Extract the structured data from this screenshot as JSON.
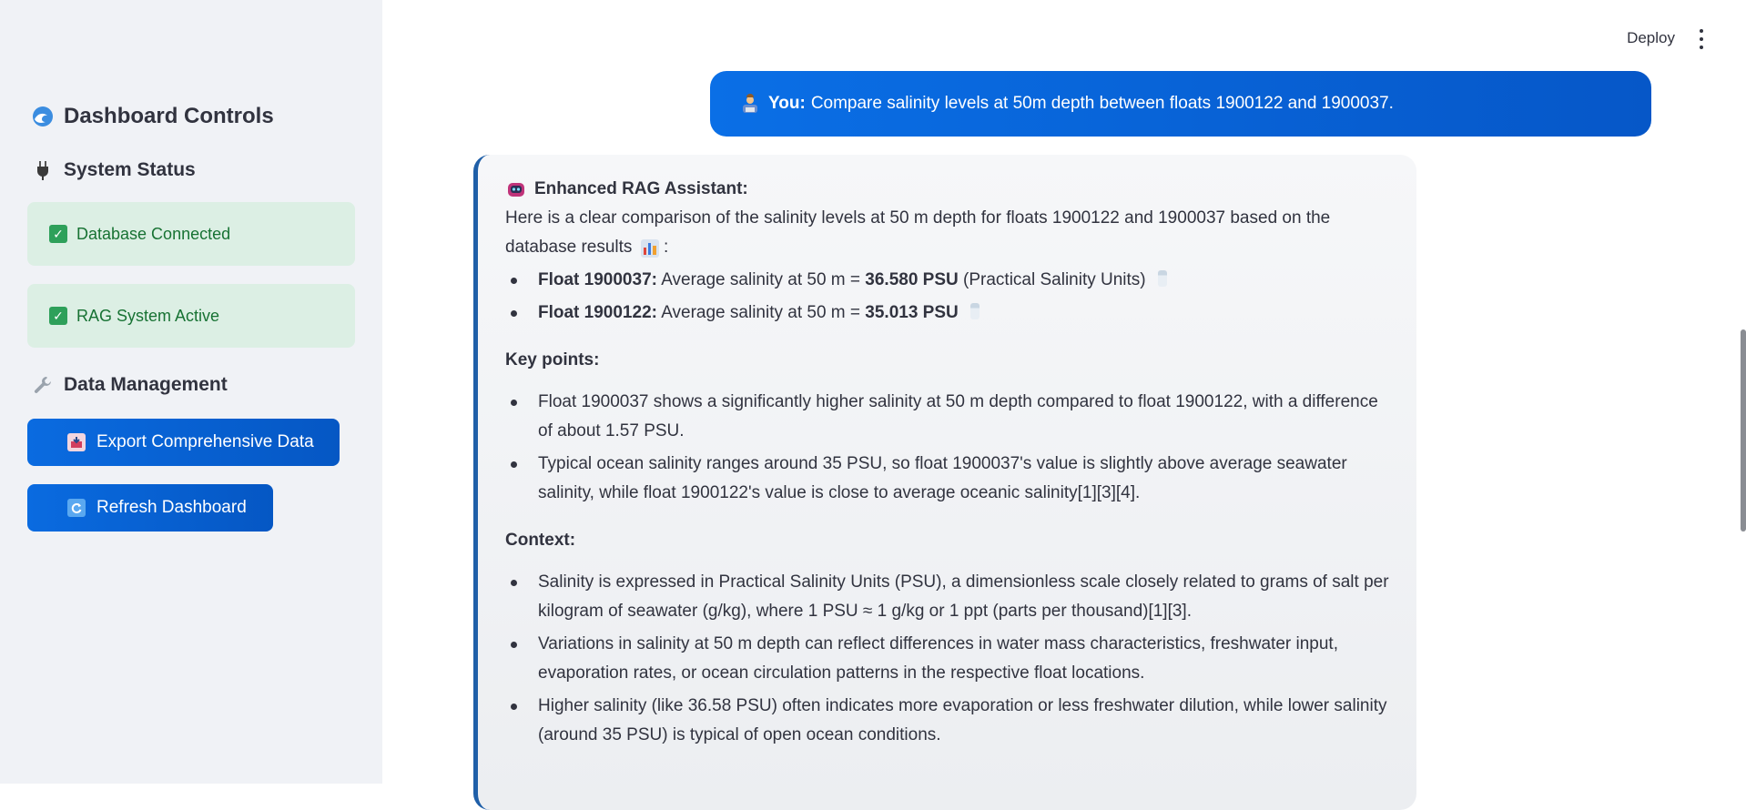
{
  "sidebar": {
    "title": "Dashboard Controls",
    "system_status_heading": "System Status",
    "status_items": [
      {
        "label": "Database Connected"
      },
      {
        "label": "RAG System Active"
      }
    ],
    "data_mgmt_heading": "Data Management",
    "buttons": {
      "export": "Export Comprehensive Data",
      "refresh": "Refresh Dashboard"
    }
  },
  "topbar": {
    "deploy": "Deploy"
  },
  "chat": {
    "user": {
      "speaker": "You:",
      "text": "Compare salinity levels at 50m depth between floats 1900122 and 1900037."
    },
    "assistant": {
      "speaker": "Enhanced RAG Assistant:",
      "intro": "Here is a clear comparison of the salinity levels at 50 m depth for floats 1900122 and 1900037 based on the database results",
      "intro_tail": ":",
      "floats": [
        {
          "label": "Float 1900037:",
          "pre": "Average salinity at 50 m =",
          "value": "36.580 PSU",
          "post": "(Practical Salinity Units)"
        },
        {
          "label": "Float 1900122:",
          "pre": "Average salinity at 50 m =",
          "value": "35.013 PSU",
          "post": ""
        }
      ],
      "key_points_title": "Key points:",
      "key_points": [
        "Float 1900037 shows a significantly higher salinity at 50 m depth compared to float 1900122, with a difference of about 1.57 PSU.",
        "Typical ocean salinity ranges around 35 PSU, so float 1900037's value is slightly above average seawater salinity, while float 1900122's value is close to average oceanic salinity[1][3][4]."
      ],
      "context_title": "Context:",
      "context": [
        "Salinity is expressed in Practical Salinity Units (PSU), a dimensionless scale closely related to grams of salt per kilogram of seawater (g/kg), where 1 PSU ≈ 1 g/kg or 1 ppt (parts per thousand)[1][3].",
        "Variations in salinity at 50 m depth can reflect differences in water mass characteristics, freshwater input, evaporation rates, or ocean circulation patterns in the respective float locations.",
        "Higher salinity (like 36.58 PSU) often indicates more evaporation or less freshwater dilution, while lower salinity (around 35 PSU) is typical of open ocean conditions."
      ]
    }
  },
  "colors": {
    "primary_button": "#0a6be0",
    "success_bg": "#dcefe4",
    "success_text": "#177233",
    "assistant_border": "#1f5fa8"
  },
  "icons": {
    "title": "wave-icon",
    "system_status": "plug-icon",
    "status_check": "check-icon",
    "data_management": "wrench-icon",
    "export": "inbox-icon",
    "refresh": "refresh-icon",
    "user": "person-icon",
    "assistant": "robot-icon",
    "chart": "bar-chart-icon",
    "salt": "salt-icon",
    "menu": "more-vertical-icon"
  }
}
